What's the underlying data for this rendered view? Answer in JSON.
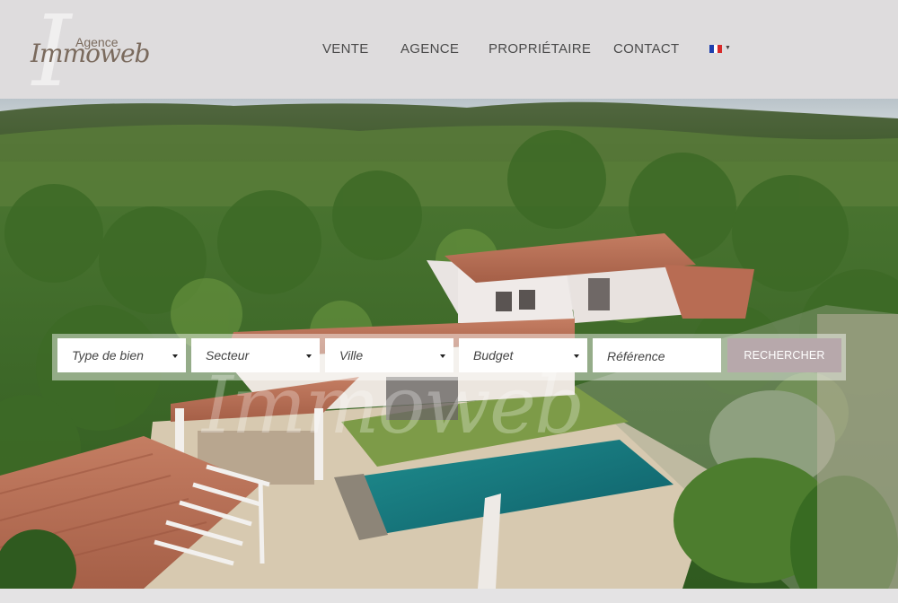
{
  "header": {
    "logo": {
      "monogram": "I",
      "agence": "Agence",
      "name": "Immoweb"
    },
    "nav": [
      {
        "label": "VENTE"
      },
      {
        "label": "AGENCE"
      },
      {
        "label": "PROPRIÉTAIRE"
      },
      {
        "label": "CONTACT"
      }
    ],
    "language": {
      "icon": "french-flag-icon",
      "colors": [
        "#1f3fae",
        "#ffffff",
        "#d82a2a"
      ]
    }
  },
  "hero": {
    "watermark": "Immoweb"
  },
  "search": {
    "fields": [
      {
        "label": "Type de bien",
        "type": "select"
      },
      {
        "label": "Secteur",
        "type": "select"
      },
      {
        "label": "Ville",
        "type": "select"
      },
      {
        "label": "Budget",
        "type": "select"
      }
    ],
    "reference_placeholder": "Référence",
    "button_label": "RECHERCHER",
    "button_color": "#b7a8ab"
  }
}
